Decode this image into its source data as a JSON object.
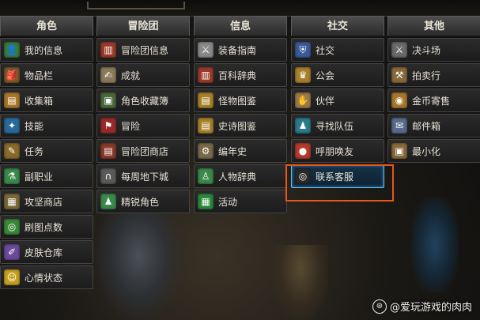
{
  "columns": [
    {
      "header": "角色",
      "items": [
        {
          "label": "我的信息",
          "icon": "profile-icon",
          "glyph": "👤",
          "color": "#3a7a3a"
        },
        {
          "label": "物品栏",
          "icon": "bag-icon",
          "glyph": "🎒",
          "color": "#7a5a2a"
        },
        {
          "label": "收集箱",
          "icon": "chest-icon",
          "glyph": "▤",
          "color": "#a8782a"
        },
        {
          "label": "技能",
          "icon": "skill-icon",
          "glyph": "✦",
          "color": "#2a6a9a"
        },
        {
          "label": "任务",
          "icon": "scroll-icon",
          "glyph": "✎",
          "color": "#8a6a2a"
        },
        {
          "label": "副职业",
          "icon": "potion-icon",
          "glyph": "⚗",
          "color": "#3a8a4a"
        },
        {
          "label": "攻坚商店",
          "icon": "shop-icon",
          "glyph": "▦",
          "color": "#7a6a3a"
        },
        {
          "label": "刷图点数",
          "icon": "points-icon",
          "glyph": "◎",
          "color": "#3a8a3a"
        },
        {
          "label": "皮肤仓库",
          "icon": "brush-icon",
          "glyph": "✐",
          "color": "#6a4a9a"
        },
        {
          "label": "心情状态",
          "icon": "smile-icon",
          "glyph": "☺",
          "color": "#c8a020"
        }
      ]
    },
    {
      "header": "冒险团",
      "items": [
        {
          "label": "冒险团信息",
          "icon": "guild-info-icon",
          "glyph": "▥",
          "color": "#9a3a2a"
        },
        {
          "label": "成就",
          "icon": "achievement-icon",
          "glyph": "✍",
          "color": "#8a7a5a"
        },
        {
          "label": "角色收藏簿",
          "icon": "album-icon",
          "glyph": "▣",
          "color": "#4a6a3a"
        },
        {
          "label": "冒险",
          "icon": "flag-icon",
          "glyph": "⚑",
          "color": "#9a2a2a"
        },
        {
          "label": "冒险团商店",
          "icon": "guild-shop-icon",
          "glyph": "▤",
          "color": "#8a3a2a"
        },
        {
          "label": "每周地下城",
          "icon": "dungeon-gate-icon",
          "glyph": "∩",
          "color": "#5a5a5a"
        },
        {
          "label": "精锐角色",
          "icon": "elite-icon",
          "glyph": "♟",
          "color": "#3a8a4a"
        }
      ]
    },
    {
      "header": "信息",
      "items": [
        {
          "label": "装备指南",
          "icon": "equip-guide-icon",
          "glyph": "⚔",
          "color": "#8a8a8a"
        },
        {
          "label": "百科辞典",
          "icon": "book-icon",
          "glyph": "▥",
          "color": "#9a3a2a"
        },
        {
          "label": "怪物图鉴",
          "icon": "monster-book-icon",
          "glyph": "▤",
          "color": "#a8822a"
        },
        {
          "label": "史诗图鉴",
          "icon": "epic-book-icon",
          "glyph": "▤",
          "color": "#a8822a"
        },
        {
          "label": "编年史",
          "icon": "gear-icon",
          "glyph": "⚙",
          "color": "#7a6a4a"
        },
        {
          "label": "人物辞典",
          "icon": "character-dict-icon",
          "glyph": "♙",
          "color": "#3a8a4a"
        },
        {
          "label": "活动",
          "icon": "calendar-icon",
          "glyph": "▦",
          "color": "#2a8a3a"
        }
      ]
    },
    {
      "header": "社交",
      "items": [
        {
          "label": "社交",
          "icon": "social-shield-icon",
          "glyph": "⛨",
          "color": "#3a5a9a"
        },
        {
          "label": "公会",
          "icon": "guild-eagle-icon",
          "glyph": "♛",
          "color": "#a8822a"
        },
        {
          "label": "伙伴",
          "icon": "handshake-icon",
          "glyph": "✋",
          "color": "#9a7a4a"
        },
        {
          "label": "寻找队伍",
          "icon": "party-icon",
          "glyph": "♟",
          "color": "#2a7a8a"
        },
        {
          "label": "呼朋唤友",
          "icon": "friend-call-icon",
          "glyph": "●",
          "color": "#b83a2a"
        },
        {
          "label": "联系客服",
          "icon": "headset-icon",
          "glyph": "◎",
          "color": "#2a2a2a",
          "highlight": true
        }
      ]
    },
    {
      "header": "其他",
      "items": [
        {
          "label": "决斗场",
          "icon": "swords-icon",
          "glyph": "⚔",
          "color": "#6a6a6a"
        },
        {
          "label": "拍卖行",
          "icon": "gavel-icon",
          "glyph": "⚒",
          "color": "#8a6a3a"
        },
        {
          "label": "金币寄售",
          "icon": "coin-bag-icon",
          "glyph": "◉",
          "color": "#a8782a"
        },
        {
          "label": "邮件箱",
          "icon": "mail-icon",
          "glyph": "✉",
          "color": "#5a6a8a"
        },
        {
          "label": "最小化",
          "icon": "minimize-icon",
          "glyph": "▣",
          "color": "#8a6a3a"
        }
      ]
    }
  ],
  "watermark": {
    "text": "@爱玩游戏的肉肉"
  }
}
